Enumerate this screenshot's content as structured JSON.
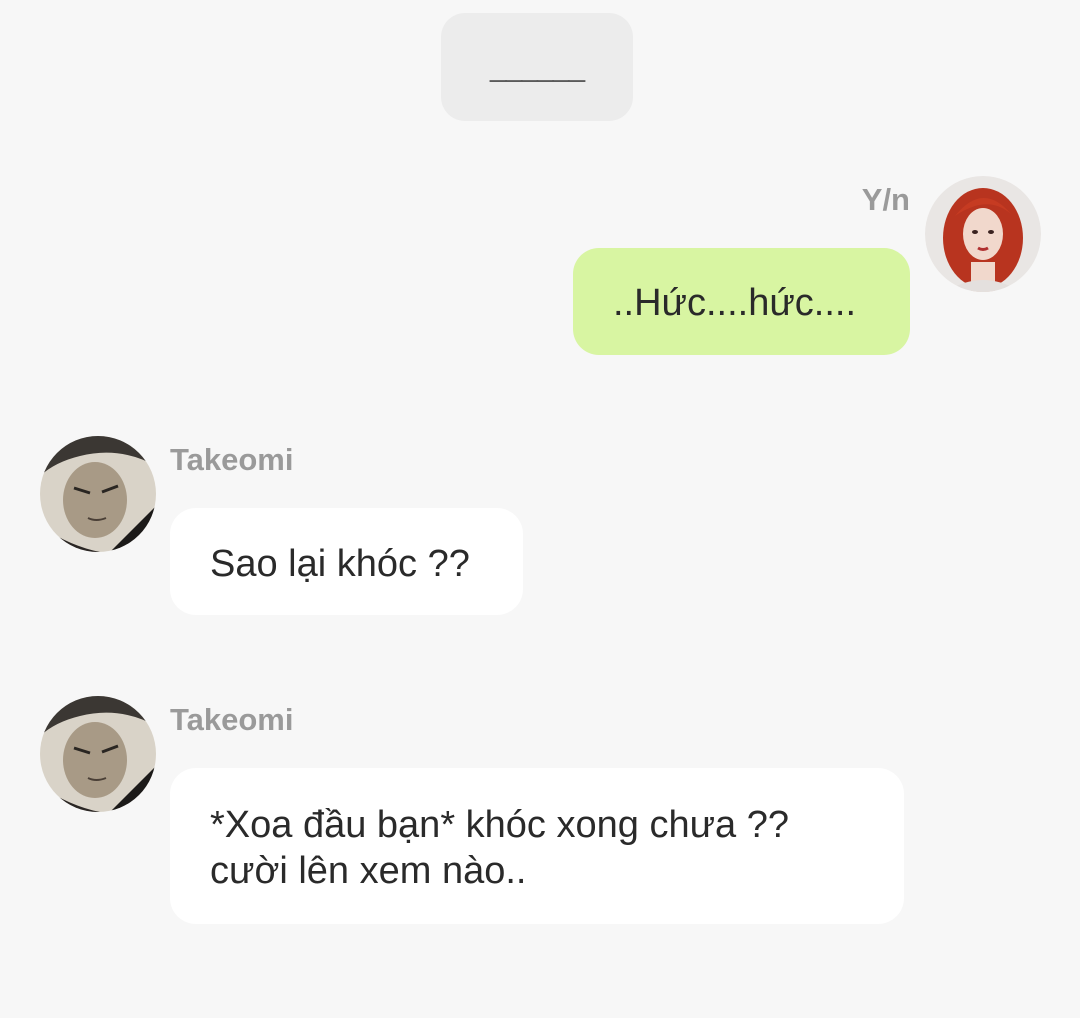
{
  "separator": {
    "text": "______"
  },
  "messages": [
    {
      "sender": "Y/n",
      "side": "right",
      "avatar_icon": "red-haired-girl-avatar-icon",
      "lines": [
        "..Hức....hức...."
      ]
    },
    {
      "sender": "Takeomi",
      "side": "left",
      "avatar_icon": "takeomi-avatar-icon",
      "lines": [
        "Sao lại khóc ??"
      ]
    },
    {
      "sender": "Takeomi",
      "side": "left",
      "avatar_icon": "takeomi-avatar-icon",
      "lines": [
        "*Xoa đầu bạn* khóc xong chưa ??",
        "cười lên xem nào.."
      ]
    }
  ],
  "colors": {
    "background": "#f7f7f7",
    "my_bubble": "#d8f5a2",
    "their_bubble": "#ffffff",
    "sender_name": "#9a9a9a"
  }
}
